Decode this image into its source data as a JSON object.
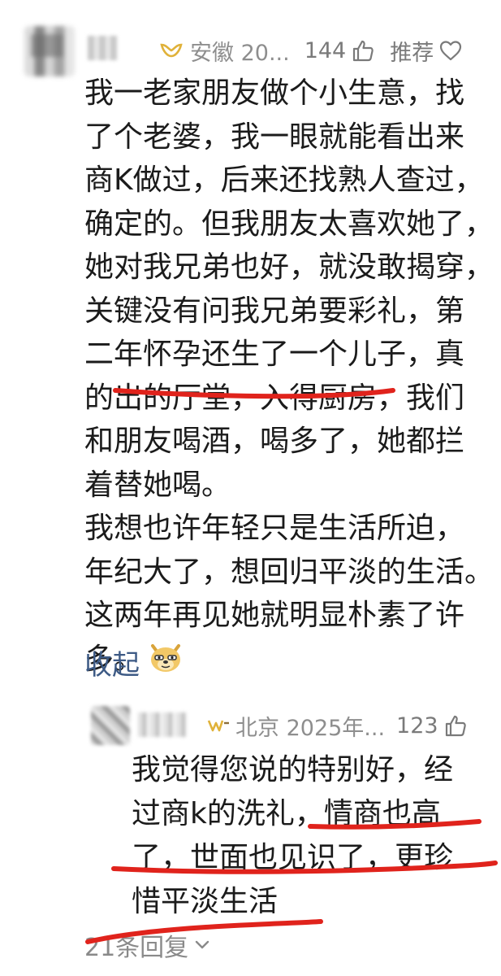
{
  "comment": {
    "location": "安徽 20...",
    "likes": "144",
    "recommend_label": "推荐",
    "lines": [
      "我一老家朋友做个小生意，找",
      "了个老婆，我一眼就能看出来",
      "商K做过，后来还找熟人查过，",
      "确定的。但我朋友太喜欢她了，",
      "她对我兄弟也好，就没敢揭穿，",
      "关键没有问我兄弟要彩礼，第",
      "二年怀孕还生了一个儿子，真",
      "的出的厅堂，入得厨房，我们",
      "和朋友喝酒，喝多了，她都拦",
      "着替她喝。",
      "我想也许年轻只是生活所迫，",
      "年纪大了，想回归平淡的生活。",
      "这两年再见她就明显朴素了许",
      "多。"
    ],
    "collapse_label": "收起",
    "emoji": "doge-emoji"
  },
  "reply": {
    "location": "北京 2025年...",
    "likes": "123",
    "lines": [
      "我觉得您说的特别好，经",
      "过商k的洗礼，情商也高",
      "了，世面也见识了，更珍",
      "惜平淡生活"
    ]
  },
  "replies_footer": {
    "label": "21条回复"
  },
  "annotation_color": "#e0231c",
  "link_color": "#3d5a85"
}
